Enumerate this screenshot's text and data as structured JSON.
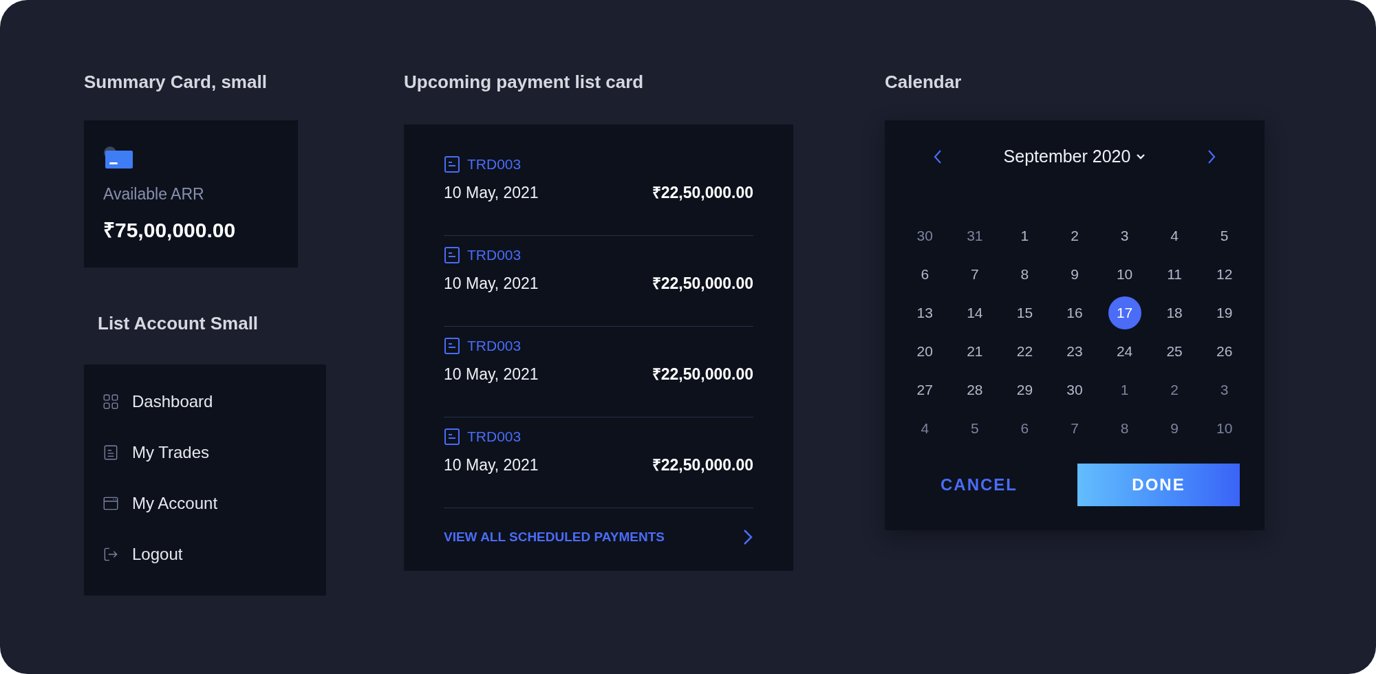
{
  "summary_card": {
    "heading": "Summary Card, small",
    "label": "Available ARR",
    "value": "₹75,00,000.00"
  },
  "account_list": {
    "heading": "List Account Small",
    "items": [
      {
        "label": "Dashboard",
        "kind": "grid"
      },
      {
        "label": "My Trades",
        "kind": "document"
      },
      {
        "label": "My Account",
        "kind": "window"
      },
      {
        "label": "Logout",
        "kind": "logout"
      }
    ]
  },
  "payment_list": {
    "heading": "Upcoming payment list card",
    "payments": [
      {
        "id": "TRD003",
        "date": "10 May, 2021",
        "amount": "₹22,50,000.00"
      },
      {
        "id": "TRD003",
        "date": "10 May, 2021",
        "amount": "₹22,50,000.00"
      },
      {
        "id": "TRD003",
        "date": "10 May, 2021",
        "amount": "₹22,50,000.00"
      },
      {
        "id": "TRD003",
        "date": "10 May, 2021",
        "amount": "₹22,50,000.00"
      }
    ],
    "link": "VIEW ALL SCHEDULED PAYMENTS"
  },
  "calendar": {
    "heading": "Calendar",
    "month": "September 2020",
    "days": [
      {
        "label": "30",
        "in_month": false,
        "selected": false
      },
      {
        "label": "31",
        "in_month": false,
        "selected": false
      },
      {
        "label": "1",
        "in_month": true,
        "selected": false
      },
      {
        "label": "2",
        "in_month": true,
        "selected": false
      },
      {
        "label": "3",
        "in_month": true,
        "selected": false
      },
      {
        "label": "4",
        "in_month": true,
        "selected": false
      },
      {
        "label": "5",
        "in_month": true,
        "selected": false
      },
      {
        "label": "6",
        "in_month": true,
        "selected": false
      },
      {
        "label": "7",
        "in_month": true,
        "selected": false
      },
      {
        "label": "8",
        "in_month": true,
        "selected": false
      },
      {
        "label": "9",
        "in_month": true,
        "selected": false
      },
      {
        "label": "10",
        "in_month": true,
        "selected": false
      },
      {
        "label": "11",
        "in_month": true,
        "selected": false
      },
      {
        "label": "12",
        "in_month": true,
        "selected": false
      },
      {
        "label": "13",
        "in_month": true,
        "selected": false
      },
      {
        "label": "14",
        "in_month": true,
        "selected": false
      },
      {
        "label": "15",
        "in_month": true,
        "selected": false
      },
      {
        "label": "16",
        "in_month": true,
        "selected": false
      },
      {
        "label": "17",
        "in_month": true,
        "selected": true
      },
      {
        "label": "18",
        "in_month": true,
        "selected": false
      },
      {
        "label": "19",
        "in_month": true,
        "selected": false
      },
      {
        "label": "20",
        "in_month": true,
        "selected": false
      },
      {
        "label": "21",
        "in_month": true,
        "selected": false
      },
      {
        "label": "22",
        "in_month": true,
        "selected": false
      },
      {
        "label": "23",
        "in_month": true,
        "selected": false
      },
      {
        "label": "24",
        "in_month": true,
        "selected": false
      },
      {
        "label": "25",
        "in_month": true,
        "selected": false
      },
      {
        "label": "26",
        "in_month": true,
        "selected": false
      },
      {
        "label": "27",
        "in_month": true,
        "selected": false
      },
      {
        "label": "28",
        "in_month": true,
        "selected": false
      },
      {
        "label": "29",
        "in_month": true,
        "selected": false
      },
      {
        "label": "30",
        "in_month": true,
        "selected": false
      },
      {
        "label": "1",
        "in_month": false,
        "selected": false
      },
      {
        "label": "2",
        "in_month": false,
        "selected": false
      },
      {
        "label": "3",
        "in_month": false,
        "selected": false
      },
      {
        "label": "4",
        "in_month": false,
        "selected": false
      },
      {
        "label": "5",
        "in_month": false,
        "selected": false
      },
      {
        "label": "6",
        "in_month": false,
        "selected": false
      },
      {
        "label": "7",
        "in_month": false,
        "selected": false
      },
      {
        "label": "8",
        "in_month": false,
        "selected": false
      },
      {
        "label": "9",
        "in_month": false,
        "selected": false
      },
      {
        "label": "10",
        "in_month": false,
        "selected": false
      }
    ],
    "cancel": "CANCEL",
    "done": "DONE"
  }
}
